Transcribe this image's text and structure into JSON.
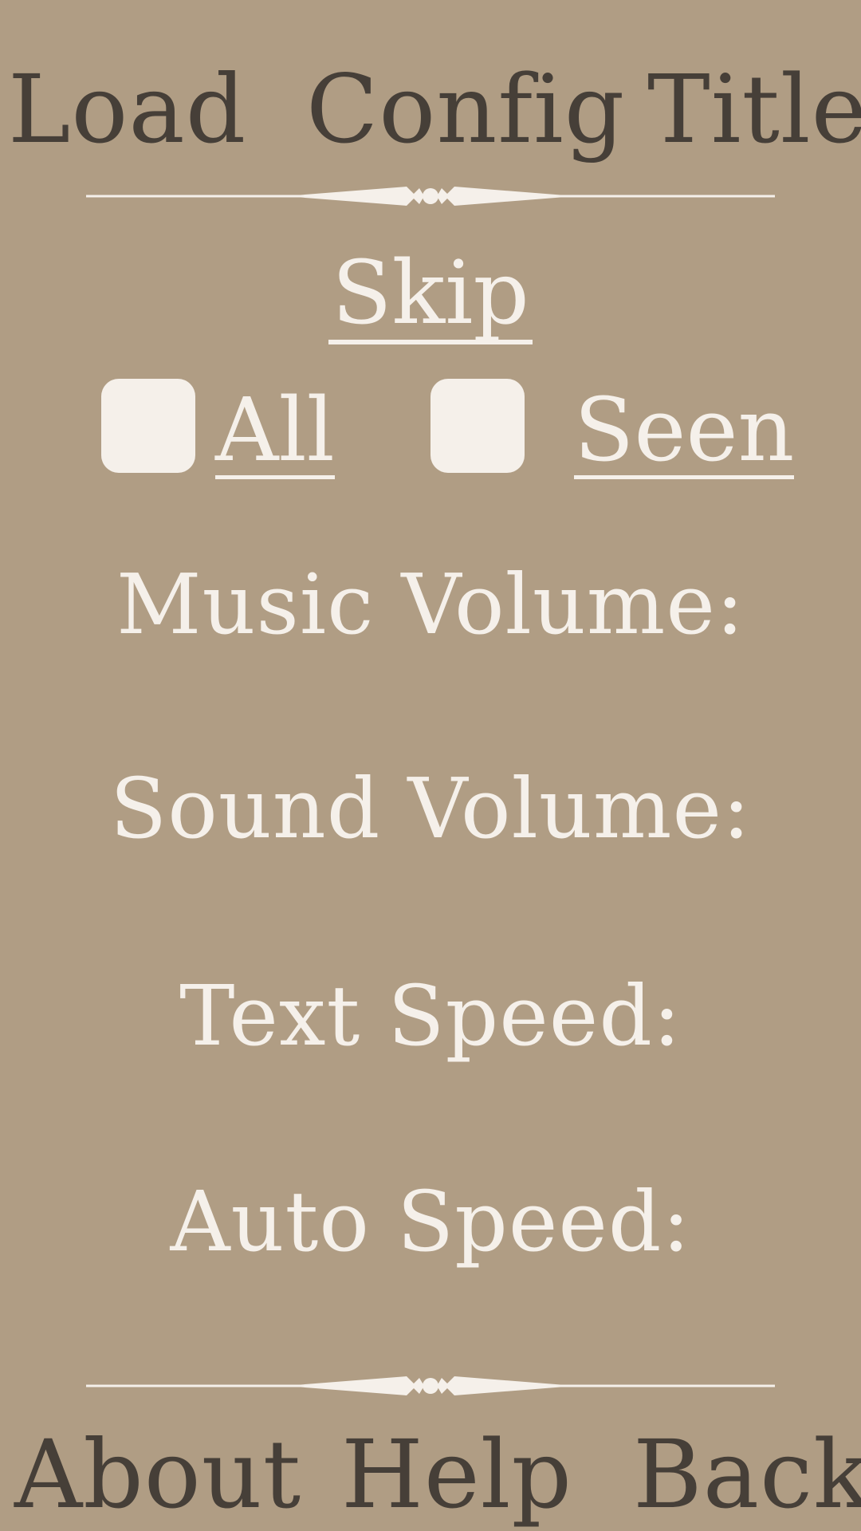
{
  "top_nav": {
    "load": "Load",
    "config": "Config",
    "title": "Title"
  },
  "skip": {
    "title": "Skip",
    "options": [
      {
        "label": "All",
        "checked": false
      },
      {
        "label": "Seen",
        "checked": false
      }
    ]
  },
  "settings": {
    "music_volume": "Music Volume:",
    "sound_volume": "Sound Volume:",
    "text_speed": "Text Speed:",
    "auto_speed": "Auto Speed:"
  },
  "bottom_nav": {
    "about": "About",
    "help": "Help",
    "back": "Back"
  },
  "colors": {
    "background": "#b09d84",
    "nav_text": "#463f38",
    "light_text": "#f5f0ea"
  },
  "icons": {
    "divider": "ornamental-divider-icon"
  }
}
